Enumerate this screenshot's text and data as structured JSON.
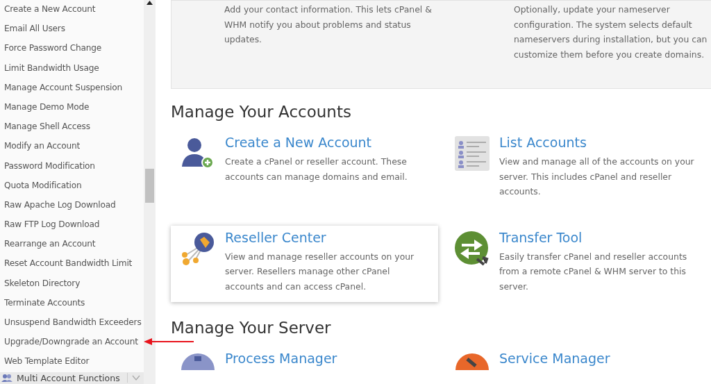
{
  "sidebar": {
    "items": [
      {
        "label": "Create a New Account"
      },
      {
        "label": "Email All Users"
      },
      {
        "label": "Force Password Change"
      },
      {
        "label": "Limit Bandwidth Usage"
      },
      {
        "label": "Manage Account Suspension"
      },
      {
        "label": "Manage Demo Mode"
      },
      {
        "label": "Manage Shell Access"
      },
      {
        "label": "Modify an Account"
      },
      {
        "label": "Password Modification"
      },
      {
        "label": "Quota Modification"
      },
      {
        "label": "Raw Apache Log Download"
      },
      {
        "label": "Raw FTP Log Download"
      },
      {
        "label": "Rearrange an Account"
      },
      {
        "label": "Reset Account Bandwidth Limit"
      },
      {
        "label": "Skeleton Directory"
      },
      {
        "label": "Terminate Accounts"
      },
      {
        "label": "Unsuspend Bandwidth Exceeders"
      },
      {
        "label": "Upgrade/Downgrade an Account"
      },
      {
        "label": "Web Template Editor"
      }
    ],
    "group": {
      "label": "Multi Account Functions",
      "expanded": false
    }
  },
  "setup_steps": [
    {
      "description": "Add your contact information. This lets cPanel & WHM notify you about problems and status updates."
    },
    {
      "description": "Optionally, update your nameserver configuration. The system selects default nameservers during installation, but you can customize them before you create domains."
    }
  ],
  "sections": [
    {
      "title": "Manage Your Accounts",
      "tools": [
        {
          "kind": "user-add",
          "title": "Create a New Account",
          "description": "Create a cPanel or reseller account. These accounts can manage domains and email.",
          "hovered": false
        },
        {
          "kind": "list",
          "title": "List Accounts",
          "description": "View and manage all of the accounts on your server. This includes cPanel and reseller accounts.",
          "hovered": false
        },
        {
          "kind": "reseller",
          "title": "Reseller Center",
          "description": "View and manage reseller accounts on your server. Resellers manage other cPanel accounts and can access cPanel.",
          "hovered": true
        },
        {
          "kind": "transfer",
          "title": "Transfer Tool",
          "description": "Easily transfer cPanel and reseller accounts from a remote cPanel & WHM server to this server.",
          "hovered": false
        }
      ]
    },
    {
      "title": "Manage Your Server",
      "tools": [
        {
          "kind": "process",
          "title": "Process Manager",
          "hovered": false
        },
        {
          "kind": "service",
          "title": "Service Manager",
          "hovered": false
        }
      ]
    }
  ]
}
